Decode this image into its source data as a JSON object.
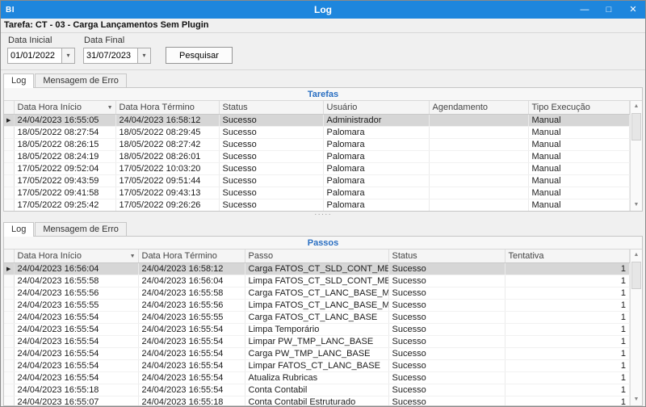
{
  "window": {
    "title": "Log",
    "app_badge": "BI",
    "controls": {
      "minimize": "—",
      "maximize": "□",
      "close": "✕"
    }
  },
  "header": {
    "task_label": "Tarefa: CT - 03 - Carga Lançamentos Sem Plugin"
  },
  "filters": {
    "data_inicial_label": "Data Inicial",
    "data_inicial_value": "01/01/2022",
    "data_final_label": "Data Final",
    "data_final_value": "31/07/2023",
    "search_button": "Pesquisar"
  },
  "tabs": {
    "log_label": "Log",
    "error_label": "Mensagem de Erro"
  },
  "icons": {
    "dropdown": "▾",
    "sort_desc": "▼",
    "row_indicator": "▶",
    "scroll_up": "▲",
    "scroll_down": "▼",
    "splitter_dots": "·····"
  },
  "tarefas": {
    "title": "Tarefas",
    "columns": [
      "Data Hora Início",
      "Data Hora Término",
      "Status",
      "Usuário",
      "Agendamento",
      "Tipo Execução"
    ],
    "rows": [
      [
        "24/04/2023 16:55:05",
        "24/04/2023 16:58:12",
        "Sucesso",
        "Administrador",
        "",
        "Manual"
      ],
      [
        "18/05/2022 08:27:54",
        "18/05/2022 08:29:45",
        "Sucesso",
        "Palomara",
        "",
        "Manual"
      ],
      [
        "18/05/2022 08:26:15",
        "18/05/2022 08:27:42",
        "Sucesso",
        "Palomara",
        "",
        "Manual"
      ],
      [
        "18/05/2022 08:24:19",
        "18/05/2022 08:26:01",
        "Sucesso",
        "Palomara",
        "",
        "Manual"
      ],
      [
        "17/05/2022 09:52:04",
        "17/05/2022 10:03:20",
        "Sucesso",
        "Palomara",
        "",
        "Manual"
      ],
      [
        "17/05/2022 09:43:59",
        "17/05/2022 09:51:44",
        "Sucesso",
        "Palomara",
        "",
        "Manual"
      ],
      [
        "17/05/2022 09:41:58",
        "17/05/2022 09:43:13",
        "Sucesso",
        "Palomara",
        "",
        "Manual"
      ],
      [
        "17/05/2022 09:25:42",
        "17/05/2022 09:26:26",
        "Sucesso",
        "Palomara",
        "",
        "Manual"
      ]
    ]
  },
  "passos": {
    "title": "Passos",
    "columns": [
      "Data Hora Início",
      "Data Hora Término",
      "Passo",
      "Status",
      "Tentativa"
    ],
    "rows": [
      [
        "24/04/2023 16:56:04",
        "24/04/2023 16:58:12",
        "Carga FATOS_CT_SLD_CONT_MES",
        "Sucesso",
        "1"
      ],
      [
        "24/04/2023 16:55:58",
        "24/04/2023 16:56:04",
        "Limpa FATOS_CT_SLD_CONT_MES",
        "Sucesso",
        "1"
      ],
      [
        "24/04/2023 16:55:56",
        "24/04/2023 16:55:58",
        "Carga FATOS_CT_LANC_BASE_MES",
        "Sucesso",
        "1"
      ],
      [
        "24/04/2023 16:55:55",
        "24/04/2023 16:55:56",
        "Limpa FATOS_CT_LANC_BASE_MES",
        "Sucesso",
        "1"
      ],
      [
        "24/04/2023 16:55:54",
        "24/04/2023 16:55:55",
        "Carga FATOS_CT_LANC_BASE",
        "Sucesso",
        "1"
      ],
      [
        "24/04/2023 16:55:54",
        "24/04/2023 16:55:54",
        "Limpa Temporário",
        "Sucesso",
        "1"
      ],
      [
        "24/04/2023 16:55:54",
        "24/04/2023 16:55:54",
        "Limpar PW_TMP_LANC_BASE",
        "Sucesso",
        "1"
      ],
      [
        "24/04/2023 16:55:54",
        "24/04/2023 16:55:54",
        "Carga PW_TMP_LANC_BASE",
        "Sucesso",
        "1"
      ],
      [
        "24/04/2023 16:55:54",
        "24/04/2023 16:55:54",
        "Limpar FATOS_CT_LANC_BASE",
        "Sucesso",
        "1"
      ],
      [
        "24/04/2023 16:55:54",
        "24/04/2023 16:55:54",
        "Atualiza Rubricas",
        "Sucesso",
        "1"
      ],
      [
        "24/04/2023 16:55:18",
        "24/04/2023 16:55:54",
        "Conta Contabil",
        "Sucesso",
        "1"
      ],
      [
        "24/04/2023 16:55:07",
        "24/04/2023 16:55:18",
        "Conta Contabil Estruturado",
        "Sucesso",
        "1"
      ]
    ]
  }
}
